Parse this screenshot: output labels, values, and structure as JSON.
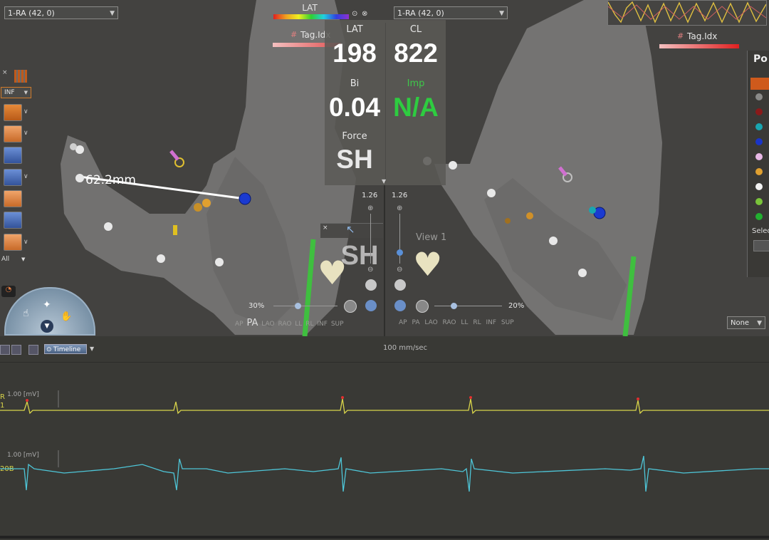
{
  "left_map": {
    "catheter_select": "1-RA (42, 0)",
    "measure_label": "62.2mm",
    "tag_index_label": "Tag.Idx"
  },
  "right_map": {
    "catheter_select": "1-RA (42, 0)",
    "tag_index_label": "Tag.Idx",
    "view_label": "View 1"
  },
  "lat_bar_label": "LAT",
  "readout": {
    "lat_label": "LAT",
    "lat_value": "198",
    "cl_label": "CL",
    "cl_value": "822",
    "bi_label": "Bi",
    "bi_value": "0.04",
    "imp_label": "Imp",
    "imp_value": "N/A",
    "force_label": "Force",
    "force_value": "SH"
  },
  "mini_force_value": "SH",
  "zoom_left": "1.26",
  "zoom_right": "1.26",
  "pct_left": "30%",
  "pct_right": "20%",
  "views_left": [
    "AP",
    "PA",
    "LAO",
    "RAO",
    "LL",
    "RL",
    "INF",
    "SUP"
  ],
  "views_right": [
    "AP",
    "PA",
    "LAO",
    "RAO",
    "LL",
    "RL",
    "INF",
    "SUP"
  ],
  "left_toolbar": {
    "filter_select": "INF",
    "all_select": "All"
  },
  "right_panel": {
    "title": "Po",
    "select_label": "Selec",
    "none_select": "None",
    "point_colors": [
      "#cf5a1c",
      "#8a8a88",
      "#8a1a1a",
      "#19a6b0",
      "#1a35c8",
      "#e8b8e6",
      "#e0a030",
      "#f2f2f2",
      "#7ac43a",
      "#22b030"
    ]
  },
  "bottom_toolbar": {
    "timeline_label": "Timeline"
  },
  "ecg": {
    "speed_label": "100 mm/sec",
    "channels": [
      {
        "scale": "1.00 [mV]",
        "label_tail": "R\n1",
        "color": "#d8d44a"
      },
      {
        "scale": "1.00 [mV]",
        "label_tail": "20B",
        "color": "#4ec6d8"
      }
    ]
  },
  "colors": {
    "imp_green": "#2ecc40",
    "accent_orange": "#d07a2a"
  }
}
